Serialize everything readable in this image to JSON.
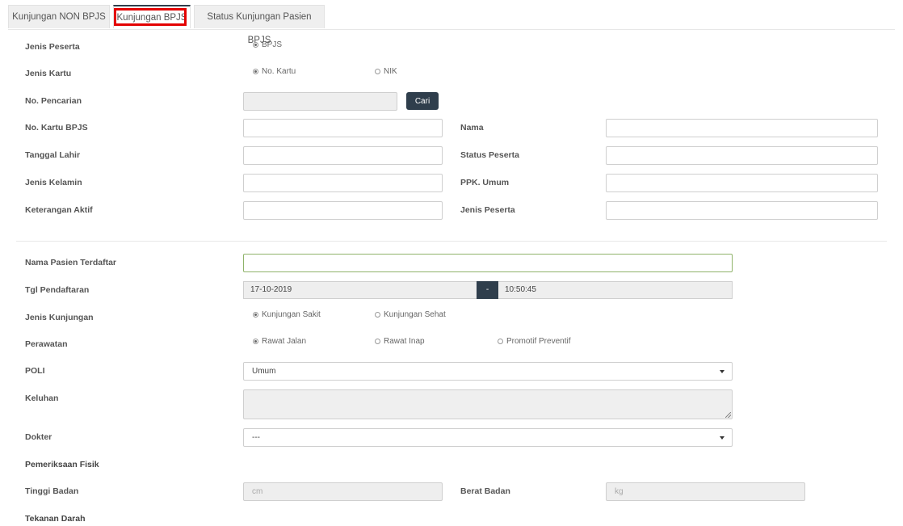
{
  "tabs": [
    {
      "label": "Kunjungan NON BPJS"
    },
    {
      "label": "Kunjungan BPJS"
    },
    {
      "label": "Status Kunjungan Pasien BPJS"
    }
  ],
  "form": {
    "jenis_peserta": {
      "label": "Jenis Peserta",
      "option": "BPJS"
    },
    "jenis_kartu": {
      "label": "Jenis Kartu",
      "options": [
        "No. Kartu",
        "NIK"
      ]
    },
    "no_pencarian": {
      "label": "No. Pencarian",
      "value": "",
      "button": "Cari"
    },
    "no_kartu_bpjs": {
      "label": "No. Kartu BPJS",
      "value": ""
    },
    "nama": {
      "label": "Nama",
      "value": ""
    },
    "tanggal_lahir": {
      "label": "Tanggal Lahir",
      "value": ""
    },
    "status_peserta": {
      "label": "Status Peserta",
      "value": ""
    },
    "jenis_kelamin": {
      "label": "Jenis Kelamin",
      "value": ""
    },
    "ppk_umum": {
      "label": "PPK. Umum",
      "value": ""
    },
    "keterangan_aktif": {
      "label": "Keterangan Aktif",
      "value": ""
    },
    "jenis_peserta_info": {
      "label": "Jenis Peserta",
      "value": ""
    },
    "nama_pasien": {
      "label": "Nama Pasien Terdaftar",
      "value": ""
    },
    "tgl_pendaftaran": {
      "label": "Tgl Pendaftaran",
      "date": "17-10-2019",
      "separator": "-",
      "time": "10:50:45"
    },
    "jenis_kunjungan": {
      "label": "Jenis Kunjungan",
      "options": [
        "Kunjungan Sakit",
        "Kunjungan Sehat"
      ]
    },
    "perawatan": {
      "label": "Perawatan",
      "options": [
        "Rawat Jalan",
        "Rawat Inap",
        "Promotif Preventif"
      ]
    },
    "poli": {
      "label": "POLI",
      "value": "Umum"
    },
    "keluhan": {
      "label": "Keluhan",
      "value": ""
    },
    "dokter": {
      "label": "Dokter",
      "value": "---"
    },
    "pemeriksaan_fisik": {
      "label": "Pemeriksaan Fisik"
    },
    "tinggi_badan": {
      "label": "Tinggi Badan",
      "placeholder": "cm"
    },
    "berat_badan": {
      "label": "Berat Badan",
      "placeholder": "kg"
    },
    "tekanan_darah": {
      "label": "Tekanan Darah"
    }
  }
}
